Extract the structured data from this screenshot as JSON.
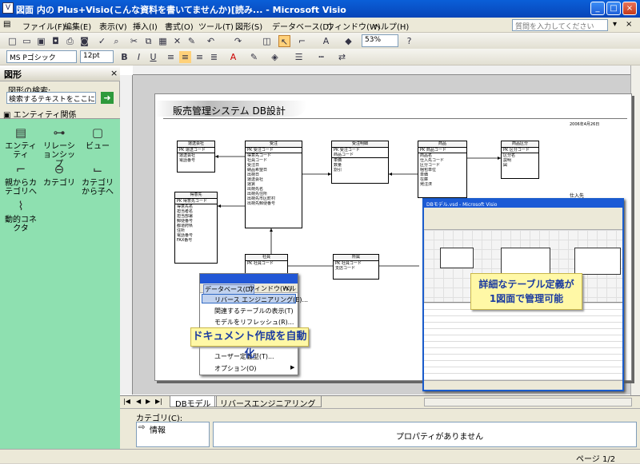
{
  "window": {
    "title": "図面 内の Plus+Visio(こんな資料を書いてませんか)[読み... - Microsoft Visio"
  },
  "menu": [
    "ファイル(F)",
    "編集(E)",
    "表示(V)",
    "挿入(I)",
    "書式(O)",
    "ツール(T)",
    "図形(S)",
    "データベース(D)",
    "ウィンドウ(W)",
    "ヘルプ(H)"
  ],
  "help_placeholder": "質問を入力してください",
  "toolbar": {
    "zoom": "53%",
    "font": "MS Pゴシック",
    "size": "12pt"
  },
  "left": {
    "title": "図形",
    "search_label": "図形の検索:",
    "search_placeholder": "検索するテキストをここに入",
    "stencil": "エンティティ関係",
    "shapes": [
      "エンティティ",
      "リレーションシップ",
      "ビュー",
      "親からカテゴリへ",
      "カテゴリ",
      "カテゴリから子へ",
      "動的コネクタ"
    ]
  },
  "diagram": {
    "title": "販売管理システム DB設計",
    "date": "2006年4月26日",
    "tables": [
      {
        "name": "運送会社",
        "pk": "運送コード",
        "cols": [
          "運送会社",
          "電話番号"
        ]
      },
      {
        "name": "受注",
        "pk": "受注コード",
        "cols": [
          "得意先コード",
          "社員コード",
          "受注日",
          "納品希望日",
          "出荷日",
          "運送会社",
          "運賃",
          "出荷先名",
          "出荷先住所",
          "出荷先市区町村",
          "出荷先郵便番号"
        ]
      },
      {
        "name": "受注明細",
        "pk": "受注コード",
        "cols": [
          "商品コード",
          "単価",
          "数量",
          "割引"
        ]
      },
      {
        "name": "商品",
        "pk": "商品コード",
        "cols": [
          "商品名",
          "仕入先コード",
          "区分コード",
          "梱包単位",
          "単価",
          "在庫",
          "発注済",
          "発注点",
          "販売中止"
        ]
      },
      {
        "name": "商品区分",
        "pk": "区分コード",
        "cols": [
          "区分名",
          "説明",
          "図"
        ]
      },
      {
        "name": "得意先",
        "pk": "得意先コード",
        "cols": [
          "得意先名",
          "担当者名",
          "担当部署",
          "郵便番号",
          "都道府県",
          "住所",
          "電話番号",
          "FAX番号"
        ]
      },
      {
        "name": "社員",
        "pk": "社員コード",
        "cols": []
      },
      {
        "name": "所属",
        "pk": "社員コード",
        "cols": [
          "支店コード"
        ]
      },
      {
        "name": "仕入先",
        "pk": "",
        "cols": []
      }
    ]
  },
  "context_menu": {
    "bar": [
      "データベース(D)",
      "ウィンドウ(W)",
      "ヘル"
    ],
    "items": [
      "リバース エンジニアリング(E)...",
      "関連するテーブルの表示(T)",
      "モデルをリフレッシュ(R)...",
      "ユーザー定義型(T)...",
      "オプション(O)"
    ]
  },
  "callouts": {
    "one": "ドキュメント作成を自動化",
    "two_a": "詳細なテーブル定義が",
    "two_b": "1図面で管理可能"
  },
  "inset": {
    "title": "DBモデル.vsd - Microsoft Visio"
  },
  "tabs": [
    "DBモデル",
    "リバースエンジニアリング"
  ],
  "properties": {
    "label": "カテゴリ(C):",
    "item": "情報",
    "empty": "プロパティがありません"
  },
  "status": {
    "page": "ページ 1/2"
  }
}
